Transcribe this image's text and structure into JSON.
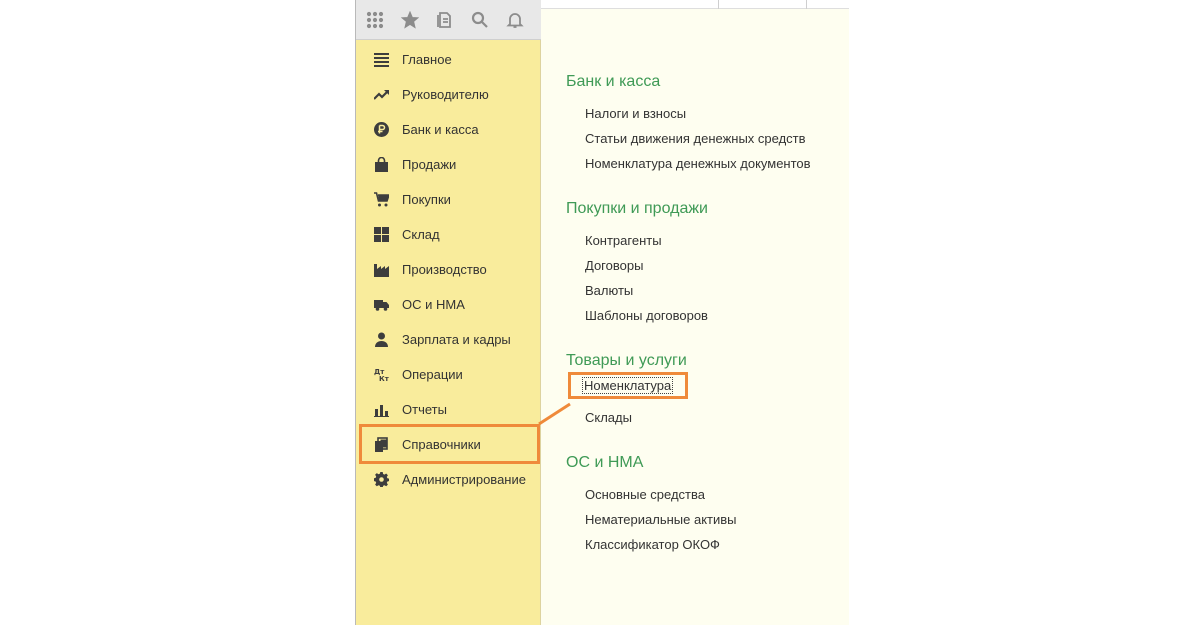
{
  "toolbar": {
    "icons": [
      "apps-grid-icon",
      "favorites-star-icon",
      "history-icon",
      "search-icon",
      "notifications-bell-icon"
    ]
  },
  "sidebar": {
    "items": [
      {
        "label": "Главное",
        "icon": "menu-lines-icon"
      },
      {
        "label": "Руководителю",
        "icon": "trend-chart-icon"
      },
      {
        "label": "Банк и касса",
        "icon": "ruble-icon"
      },
      {
        "label": "Продажи",
        "icon": "shopping-bag-icon"
      },
      {
        "label": "Покупки",
        "icon": "cart-icon"
      },
      {
        "label": "Склад",
        "icon": "warehouse-grid-icon"
      },
      {
        "label": "Производство",
        "icon": "factory-icon"
      },
      {
        "label": "ОС и НМА",
        "icon": "truck-icon"
      },
      {
        "label": "Зарплата и кадры",
        "icon": "person-icon"
      },
      {
        "label": "Операции",
        "icon": "debit-credit-icon"
      },
      {
        "label": "Отчеты",
        "icon": "bar-chart-icon"
      },
      {
        "label": "Справочники",
        "icon": "books-icon",
        "active": true
      },
      {
        "label": "Администрирование",
        "icon": "gear-icon"
      }
    ]
  },
  "content": {
    "groups": [
      {
        "title": "Банк и касса",
        "links": [
          "Налоги и взносы",
          "Статьи движения денежных средств",
          "Номенклатура денежных документов"
        ]
      },
      {
        "title": "Покупки и продажи",
        "links": [
          "Контрагенты",
          "Договоры",
          "Валюты",
          "Шаблоны договоров"
        ]
      },
      {
        "title": "Товары и услуги",
        "links": [
          "Номенклатура",
          "Склады"
        ]
      },
      {
        "title": "ОС и НМА",
        "links": [
          "Основные средства",
          "Нематериальные активы",
          "Классификатор ОКОФ"
        ]
      }
    ]
  },
  "colors": {
    "sidebar_bg": "#f9ec9c",
    "content_bg": "#fefef0",
    "group_title": "#3f9a56",
    "highlight": "#ef8a3a"
  }
}
